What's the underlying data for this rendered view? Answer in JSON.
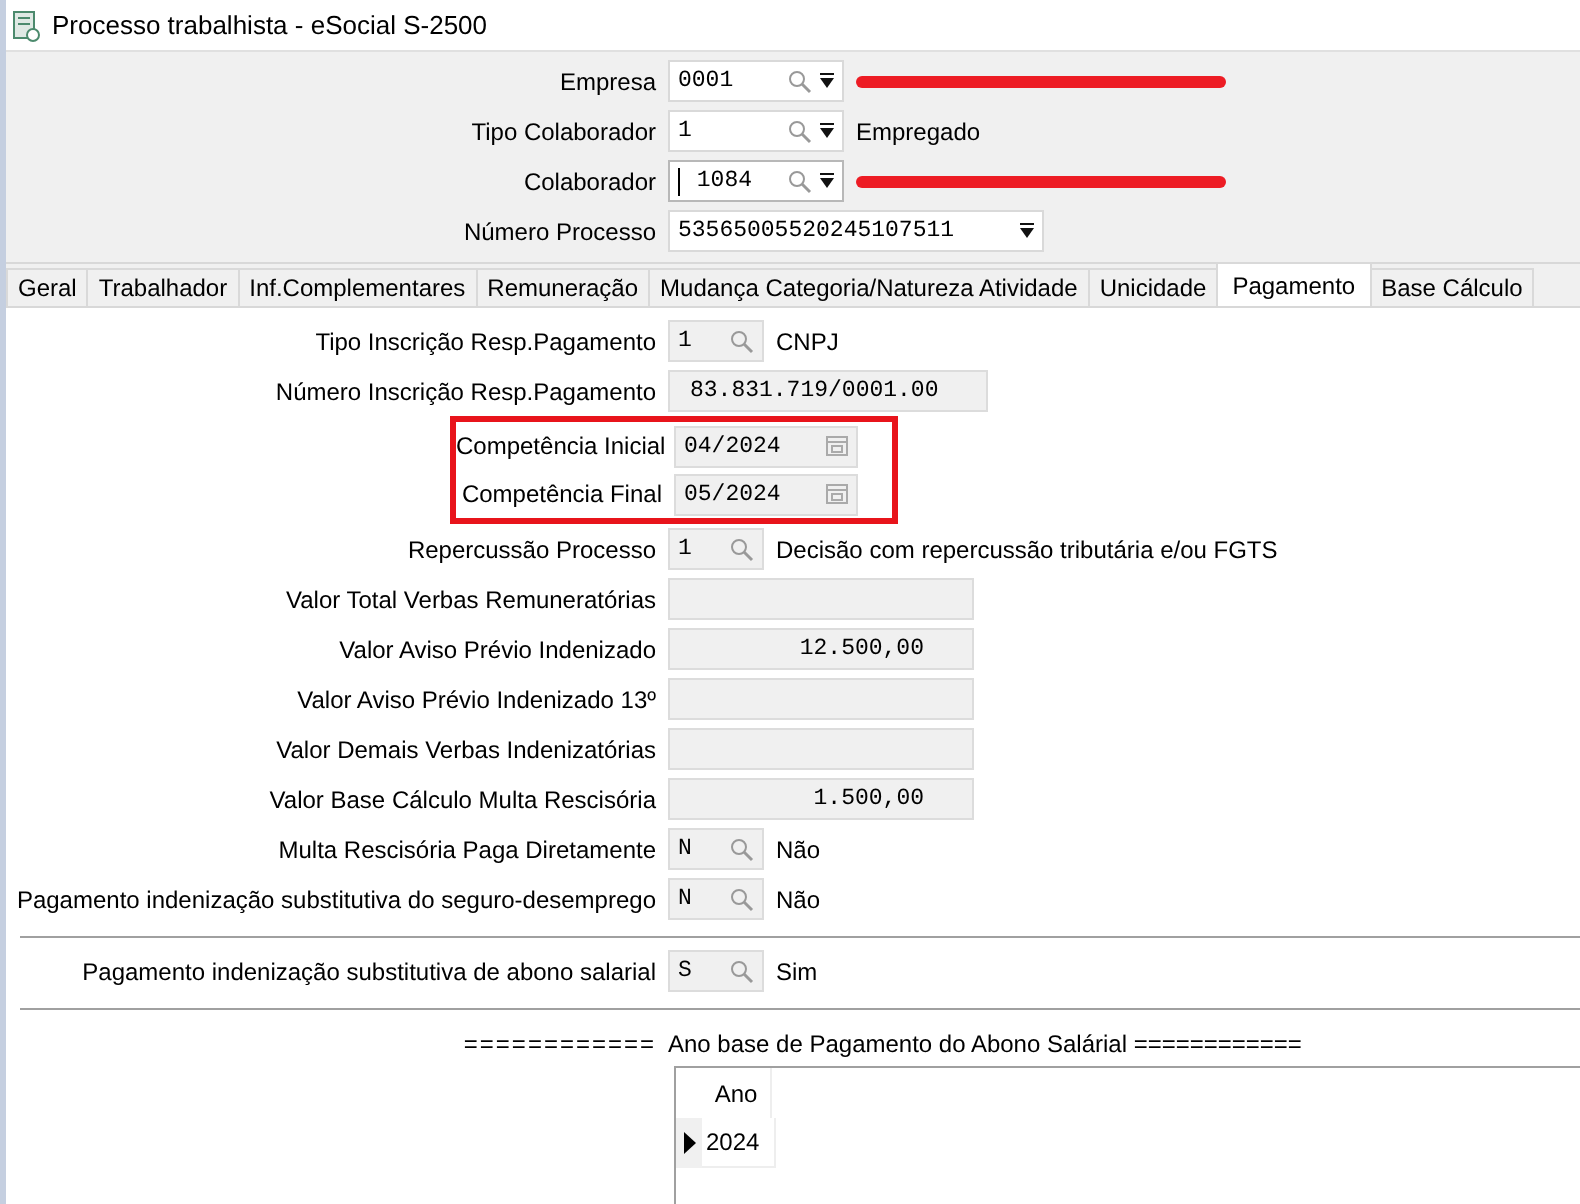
{
  "window": {
    "title": "Processo trabalhista - eSocial S-2500"
  },
  "header": {
    "fields": [
      {
        "label": "Empresa",
        "kind": "lookup",
        "value": "0001",
        "focused": false,
        "redacted": true
      },
      {
        "label": "Tipo Colaborador",
        "kind": "lookup",
        "value": "1",
        "focused": false,
        "redacted": false,
        "description": "Empregado"
      },
      {
        "label": "Colaborador",
        "kind": "number_lookup",
        "value": "1084",
        "focused": true,
        "redacted": true
      },
      {
        "label": "Número Processo",
        "kind": "select",
        "value": "53565005520245107511",
        "focused": false,
        "redacted": false
      }
    ]
  },
  "tabs": [
    {
      "label": "Geral",
      "selected": false
    },
    {
      "label": "Trabalhador",
      "selected": false
    },
    {
      "label": "Inf.Complementares",
      "selected": false
    },
    {
      "label": "Remuneração",
      "selected": false
    },
    {
      "label": "Mudança Categoria/Natureza Atividade",
      "selected": false
    },
    {
      "label": "Unicidade",
      "selected": false
    },
    {
      "label": "Pagamento",
      "selected": true
    },
    {
      "label": "Base Cálculo",
      "selected": false
    }
  ],
  "form": {
    "sections": [
      {
        "highlighted": false,
        "separated": false,
        "rows": [
          {
            "label": "Tipo Inscrição Resp.Pagamento",
            "kind": "lookup",
            "value": "1",
            "description": "CNPJ"
          },
          {
            "label": "Número Inscrição Resp.Pagamento",
            "kind": "text",
            "value": "83.831.719/0001.00"
          }
        ]
      },
      {
        "highlighted": true,
        "separated": false,
        "rows": [
          {
            "label": "Competência Inicial",
            "kind": "date",
            "value": "04/2024"
          },
          {
            "label": "Competência Final",
            "kind": "date",
            "value": "05/2024"
          }
        ]
      },
      {
        "highlighted": false,
        "separated": false,
        "rows": [
          {
            "label": "Repercussão Processo",
            "kind": "lookup",
            "value": "1",
            "description": "Decisão com repercussão tributária e/ou FGTS"
          },
          {
            "label": "Valor Total Verbas Remuneratórias",
            "kind": "amount"
          },
          {
            "label": "Valor Aviso Prévio Indenizado",
            "kind": "amount",
            "value": "12.500,00"
          },
          {
            "label": "Valor Aviso Prévio Indenizado 13º",
            "kind": "amount"
          },
          {
            "label": "Valor Demais Verbas Indenizatórias",
            "kind": "amount"
          },
          {
            "label": "Valor Base Cálculo Multa Rescisória",
            "kind": "amount",
            "value": "1.500,00"
          },
          {
            "label": "Multa Rescisória Paga Diretamente",
            "kind": "lookup",
            "value": "N",
            "description": "Não"
          },
          {
            "label": "Pagamento indenização substitutiva do seguro-desemprego",
            "kind": "lookup",
            "value": "N",
            "description": "Não"
          }
        ]
      },
      {
        "highlighted": false,
        "separated": true,
        "rows": [
          {
            "label": "Pagamento indenização substitutiva de abono salarial",
            "kind": "lookup",
            "value": "S",
            "description": "Sim"
          }
        ]
      }
    ]
  },
  "abono": {
    "heading_left": "============",
    "heading": "Ano base de Pagamento do Abono Salárial ============",
    "grid": {
      "columns": [
        "Ano"
      ],
      "rows": [
        {
          "cells": [
            "2024"
          ],
          "selected": true
        }
      ]
    }
  }
}
